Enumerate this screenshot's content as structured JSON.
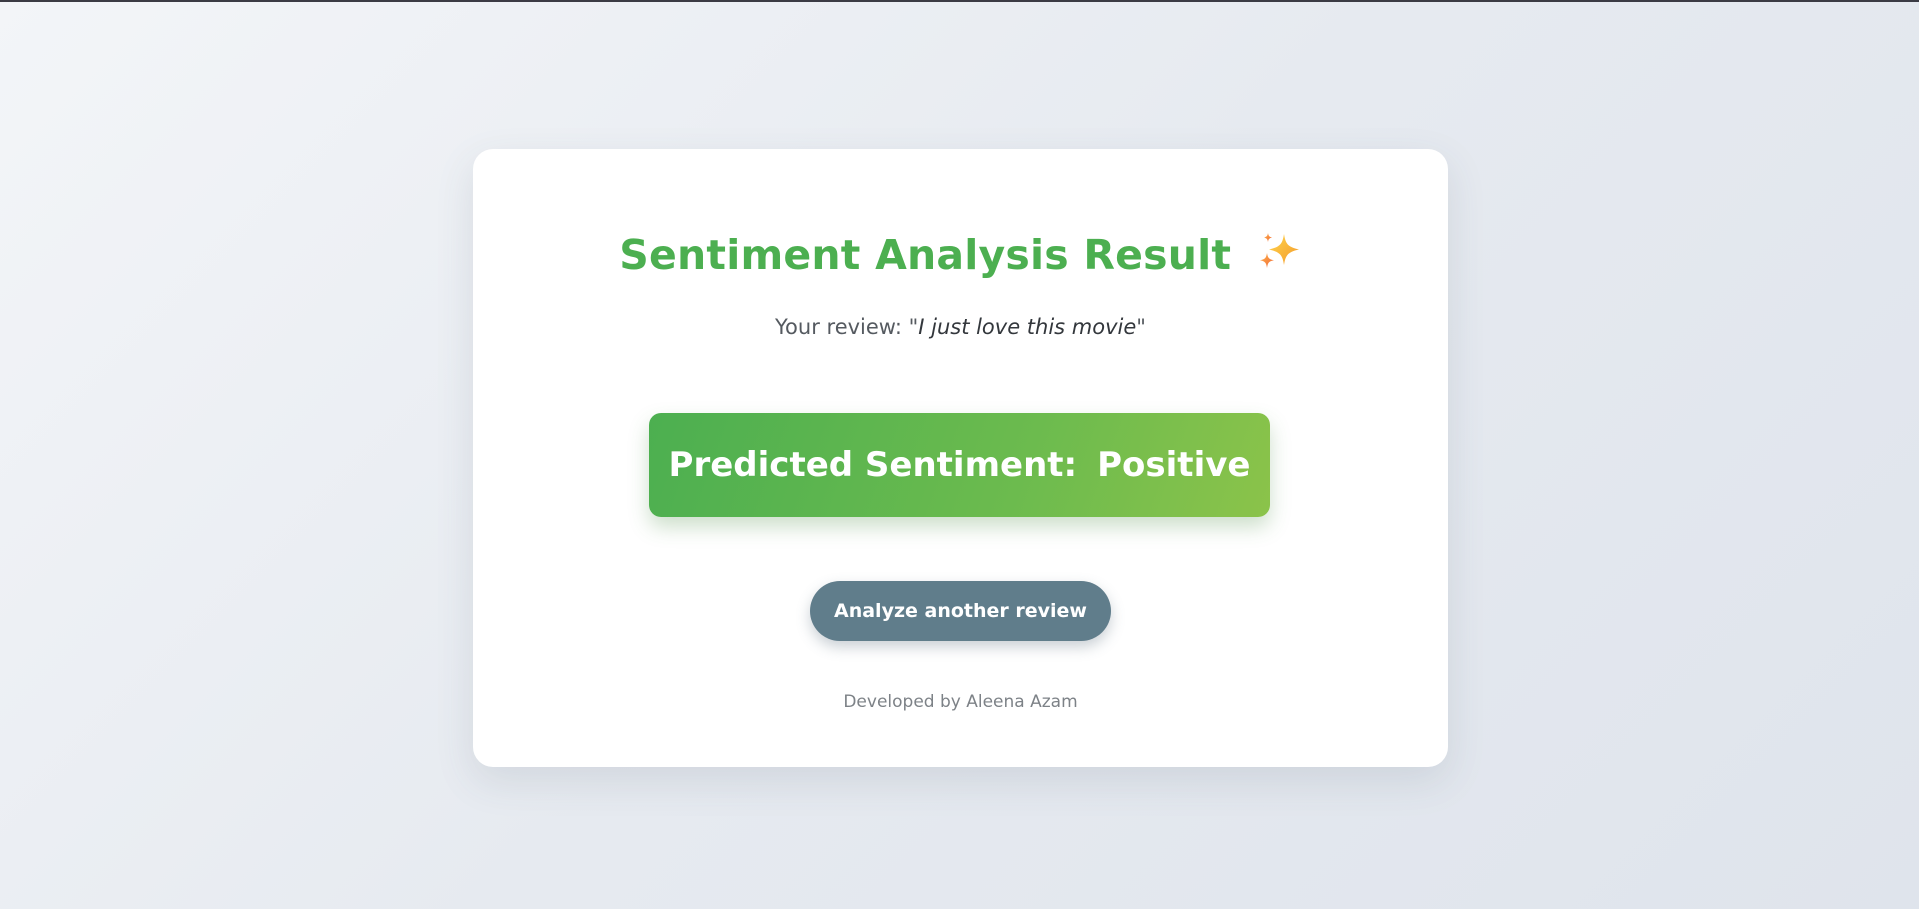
{
  "page": {
    "title": "Sentiment Analysis Result",
    "title_icon": "sparkles-icon",
    "review_prefix": "Your review: \"",
    "review_text": "I just love this movie",
    "review_suffix": "\"",
    "result_label": "Predicted Sentiment:",
    "result_value": "Positive",
    "action_button": "Analyze another review",
    "footer": "Developed by Aleena Azam"
  },
  "colors": {
    "accent": "#4caf50",
    "accent_light": "#8bc34a",
    "button": "#607d8b",
    "background": "#e6eaf0",
    "card": "#ffffff"
  }
}
